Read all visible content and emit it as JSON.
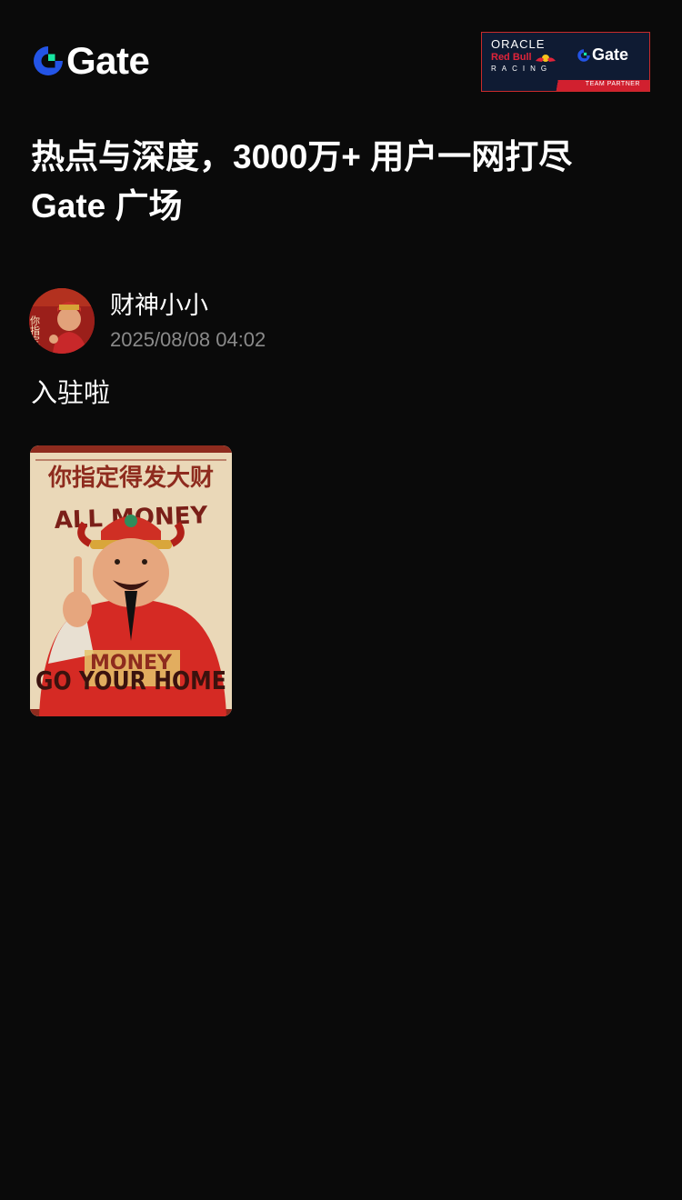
{
  "header": {
    "logo_text": "Gate",
    "partner": {
      "oracle": "ORACLE",
      "redbull": "Red Bull",
      "racing": "RACING",
      "gate": "Gate",
      "team_partner": "TEAM PARTNER"
    }
  },
  "headline": {
    "line1": "热点与深度，3000万+ 用户一网打尽",
    "line2": "Gate 广场"
  },
  "post": {
    "author_name": "财神小小",
    "timestamp": "2025/08/08 04:02",
    "text": "入驻啦",
    "avatar_text": "你指定发",
    "image": {
      "title": "你指定得发大财",
      "top_text": "ALL MONEY",
      "mid_text": "MONEY",
      "bottom_text": "GO YOUR HOME"
    }
  },
  "colors": {
    "background": "#0a0a0a",
    "brand_blue": "#2354e6",
    "brand_green": "#17e6a1",
    "secondary_text": "#8a8a8a",
    "partner_red": "#d1202f",
    "partner_navy": "#0f1b33"
  }
}
